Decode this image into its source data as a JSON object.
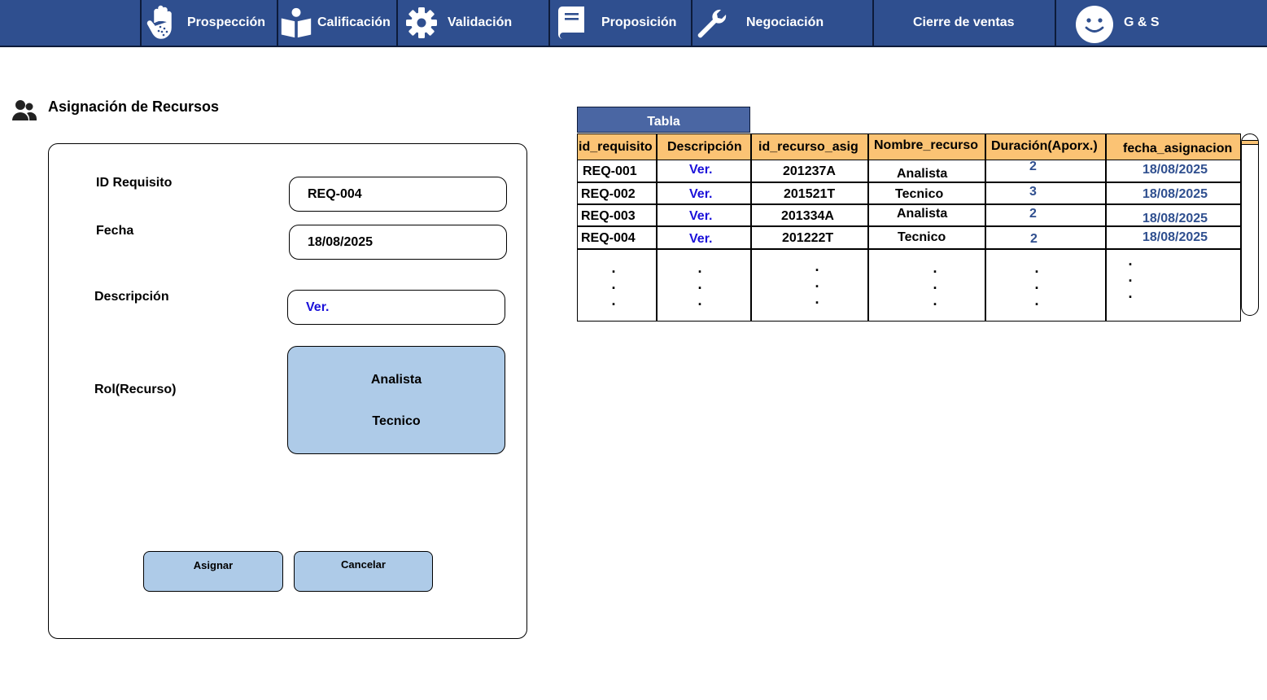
{
  "nav": {
    "items": [
      {
        "label": "Prospección",
        "icon": "hand-icon"
      },
      {
        "label": "Calificación",
        "icon": "reader-icon"
      },
      {
        "label": "Validación",
        "icon": "gear-icon"
      },
      {
        "label": "Proposición",
        "icon": "book-icon"
      },
      {
        "label": "Negociación",
        "icon": "wrench-icon"
      },
      {
        "label": "Cierre de ventas",
        "icon": ""
      }
    ],
    "user": {
      "label": "G & S",
      "icon": "smiley-icon"
    }
  },
  "section": {
    "title": "Asignación de Recursos",
    "icon": "users-icon"
  },
  "form": {
    "id_label": "ID Requisito",
    "id_value": "REQ-004",
    "fecha_label": "Fecha",
    "fecha_value": "18/08/2025",
    "descripcion_label": "Descripción",
    "descripcion_value": "Ver.",
    "rol_label": "Rol(Recurso)",
    "rol_options": [
      "Analista",
      "Tecnico"
    ],
    "assign_label": "Asignar",
    "cancel_label": "Cancelar"
  },
  "table": {
    "tab_label": "Tabla",
    "columns": [
      "id_requisito",
      "Descripción",
      "id_recurso_asig",
      "Nombre_recurso",
      "Duración(Aporx.)",
      "fecha_asignacion"
    ],
    "rows": [
      [
        "REQ-001",
        "Ver.",
        "201237A",
        "Analista",
        "2",
        "18/08/2025"
      ],
      [
        "REQ-002",
        "Ver.",
        "201521T",
        "Tecnico",
        "3",
        "18/08/2025"
      ],
      [
        "REQ-003",
        "Ver.",
        "201334A",
        "Analista",
        "2",
        "18/08/2025"
      ],
      [
        "REQ-004",
        "Ver.",
        "201222T",
        "Tecnico",
        "2",
        "18/08/2025"
      ]
    ],
    "ellipsis": "."
  },
  "colors": {
    "nav_bg": "#2f4f8f",
    "header_bg": "#fbc374",
    "accent_light": "#aecbe8",
    "link": "#1a10d9",
    "number": "#2f4f8f"
  }
}
